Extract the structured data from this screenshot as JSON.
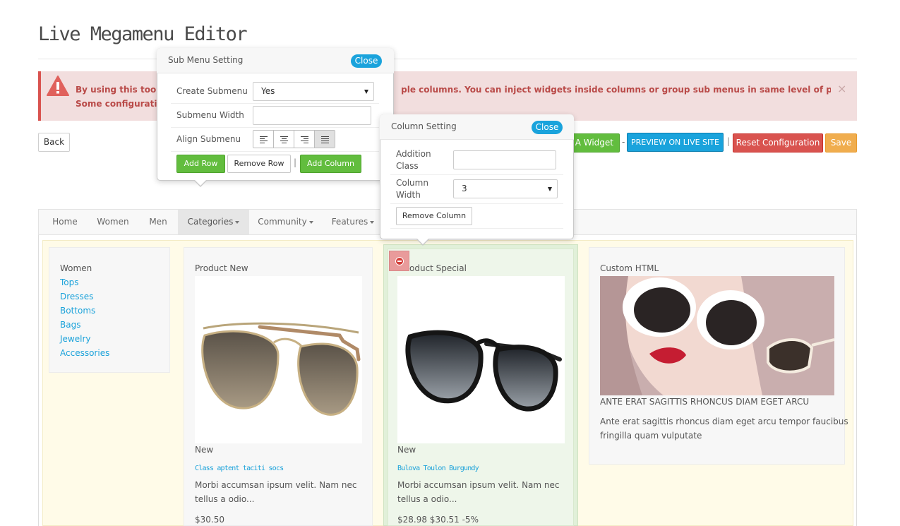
{
  "page": {
    "title": "Live Megamenu Editor"
  },
  "alert": {
    "text_line1": "By using this tool, a",
    "text_line1_end": "ple columns. You can inject widgets inside columns or group sub menus in same level of parent.Note:",
    "text_line2": "Some configuration",
    "close": "×",
    "colors": {
      "background": "#f2dede",
      "text": "#b94a48",
      "border": "#d9534f"
    }
  },
  "toolbar": {
    "back": "Back",
    "create_widget": "e A Widget",
    "dash": "-",
    "preview": "PREVIEW ON LIVE SITE",
    "pipe": "|",
    "reset": "Reset Configuration",
    "save": "Save"
  },
  "menu": {
    "items": [
      {
        "label": "Home"
      },
      {
        "label": "Women"
      },
      {
        "label": "Men"
      },
      {
        "label": "Categories"
      },
      {
        "label": "Community"
      },
      {
        "label": "Features"
      }
    ]
  },
  "columns": {
    "women": {
      "heading": "Women",
      "links": [
        "Tops",
        "Dresses",
        "Bottoms",
        "Bags",
        "Jewelry",
        "Accessories"
      ]
    },
    "product_new": {
      "heading": "Product New",
      "badge": "New",
      "name": "Class aptent taciti socs",
      "desc_line1": "Morbi accumsan ipsum velit. Nam nec",
      "desc_line2": "tellus a odio...",
      "price": "$30.50"
    },
    "product_special": {
      "heading": "oduct Special",
      "badge": "New",
      "name": "Bulova Toulon Burgundy",
      "desc_line1": "Morbi accumsan ipsum velit. Nam nec",
      "desc_line2": "tellus a odio...",
      "price": "$28.98 $30.51 -5%"
    },
    "custom_html": {
      "heading": "Custom HTML",
      "caption": "ANTE ERAT SAGITTIS RHONCUS DIAM EGET ARCU",
      "desc_line1": "Ante erat sagittis rhoncus diam eget arcu tempor faucibus",
      "desc_line2": "fringilla quam vulputate"
    }
  },
  "submenu_popup": {
    "title": "Sub Menu Setting",
    "close": "Close",
    "create_label": "Create Submenu",
    "create_value": "Yes",
    "width_label": "Submenu Width",
    "width_value": "",
    "align_label": "Align Submenu",
    "add_row": "Add Row",
    "remove_row": "Remove Row",
    "separator": "|",
    "add_column": "Add Column"
  },
  "column_popup": {
    "title": "Column Setting",
    "close": "Close",
    "class_label_1": "Addition",
    "class_label_2": "Class",
    "class_value": "",
    "width_label_1": "Column",
    "width_label_2": "Width",
    "width_value": "3",
    "remove_column": "Remove Column"
  },
  "icons": {
    "alert": "warning-triangle-icon",
    "remove": "remove-circle-icon",
    "align": [
      "align-left-icon",
      "align-center-icon",
      "align-right-icon",
      "align-justify-icon"
    ]
  }
}
